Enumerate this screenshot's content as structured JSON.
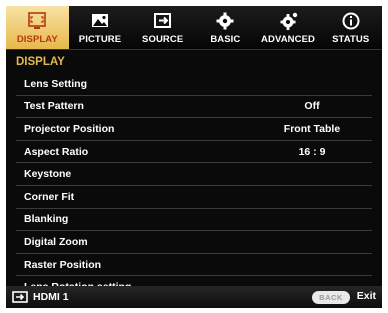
{
  "tabs": [
    {
      "label": "DISPLAY",
      "icon": "display-icon",
      "active": true
    },
    {
      "label": "PICTURE",
      "icon": "picture-icon",
      "active": false
    },
    {
      "label": "SOURCE",
      "icon": "source-icon",
      "active": false
    },
    {
      "label": "BASIC",
      "icon": "basic-gear-icon",
      "active": false
    },
    {
      "label": "ADVANCED",
      "icon": "advanced-gear-icon",
      "active": false
    },
    {
      "label": "STATUS",
      "icon": "info-icon",
      "active": false
    }
  ],
  "section_title": "DISPLAY",
  "menu": [
    {
      "label": "Lens Setting",
      "value": ""
    },
    {
      "label": "Test Pattern",
      "value": "Off"
    },
    {
      "label": "Projector Position",
      "value": "Front Table"
    },
    {
      "label": "Aspect Ratio",
      "value": "16 : 9"
    },
    {
      "label": "Keystone",
      "value": ""
    },
    {
      "label": "Corner Fit",
      "value": ""
    },
    {
      "label": "Blanking",
      "value": ""
    },
    {
      "label": "Digital Zoom",
      "value": ""
    },
    {
      "label": "Raster Position",
      "value": ""
    },
    {
      "label": "Lens Rotation setting",
      "value": ""
    }
  ],
  "footer": {
    "source": "HDMI 1",
    "back_label": "BACK",
    "exit_label": "Exit"
  },
  "colors": {
    "active_tab": "#e8b84a",
    "active_tab_text": "#b23a10",
    "section_title": "#e6b84a",
    "background": "#0a0a0a"
  }
}
